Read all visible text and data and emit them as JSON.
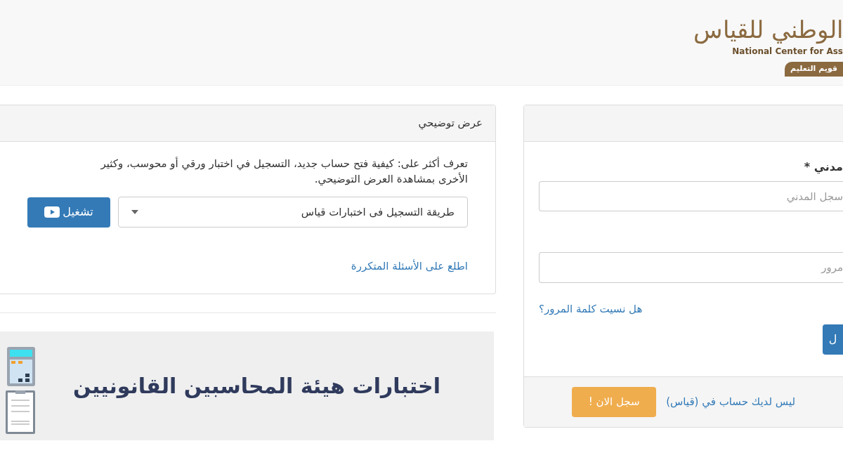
{
  "header": {
    "logo_arabic": "الوطني للقياس",
    "logo_english": "National Center for Ass",
    "logo_tagline": "قويم التعليم"
  },
  "demo_panel": {
    "title": "عرض توضيحي",
    "description_lines": [
      "تعرف أكثر على: كيفية فتح حساب جديد، التسجيل في اختبار ورقي أو محوسب، وكثير",
      "الأخرى بمشاهدة العرض التوضيحي."
    ],
    "select_value": "طريقة التسجيل فى اختبارات قياس",
    "play_button": "تشغيل",
    "faq_link": "اطلع على الأسئلة المتكررة"
  },
  "banner": {
    "title": "اختبارات هيئة المحاسبين القانونيين"
  },
  "login_panel": {
    "id_label": "مدني *",
    "id_placeholder": "سجل المدني",
    "password_placeholder": "مرور",
    "forgot_link": "هل نسيت كلمة المرور؟",
    "login_button": "ل",
    "no_account_text": "ليس لديك حساب في (قياس)",
    "register_button": "سجل الان !"
  }
}
